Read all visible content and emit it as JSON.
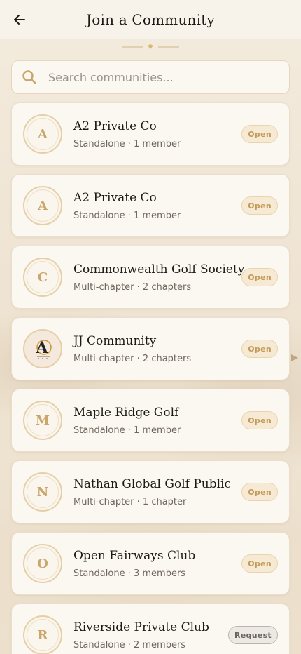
{
  "header": {
    "title": "Join a Community"
  },
  "search": {
    "placeholder": "Search communities..."
  },
  "communities": [
    {
      "initial": "A",
      "name": "A2 Private Co",
      "meta": "Standalone · 1 member",
      "action": "Open",
      "action_type": "open",
      "avatar": "initial"
    },
    {
      "initial": "A",
      "name": "A2 Private Co",
      "meta": "Standalone · 1 member",
      "action": "Open",
      "action_type": "open",
      "avatar": "initial"
    },
    {
      "initial": "C",
      "name": "Commonwealth Golf Society",
      "meta": "Multi-chapter · 2 chapters",
      "action": "Open",
      "action_type": "open",
      "avatar": "initial"
    },
    {
      "initial": "A",
      "name": "JJ Community",
      "meta": "Multi-chapter · 2 chapters",
      "action": "Open",
      "action_type": "open",
      "avatar": "logo"
    },
    {
      "initial": "M",
      "name": "Maple Ridge Golf",
      "meta": "Standalone · 1 member",
      "action": "Open",
      "action_type": "open",
      "avatar": "initial"
    },
    {
      "initial": "N",
      "name": "Nathan Global Golf Public",
      "meta": "Multi-chapter · 1 chapter",
      "action": "Open",
      "action_type": "open",
      "avatar": "initial"
    },
    {
      "initial": "O",
      "name": "Open Fairways Club",
      "meta": "Standalone · 3 members",
      "action": "Open",
      "action_type": "open",
      "avatar": "initial"
    },
    {
      "initial": "R",
      "name": "Riverside Private Club",
      "meta": "Standalone · 2 members",
      "action": "Request",
      "action_type": "request",
      "avatar": "initial"
    }
  ],
  "colors": {
    "accent_gold": "#c9a66a",
    "background": "#f1e8d9",
    "card": "#fbf8f2"
  },
  "icons": {
    "back": "arrow-left-icon",
    "search": "search-icon",
    "ornament": "diamond-divider-icon"
  }
}
